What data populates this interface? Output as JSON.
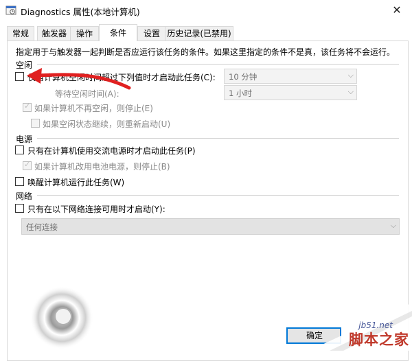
{
  "window": {
    "title": "Diagnostics 属性(本地计算机)",
    "close_glyph": "✕"
  },
  "tabs": [
    {
      "label": "常规"
    },
    {
      "label": "触发器"
    },
    {
      "label": "操作"
    },
    {
      "label": "条件"
    },
    {
      "label": "设置"
    },
    {
      "label": "历史记录(已禁用)"
    }
  ],
  "active_tab": "条件",
  "description": "指定用于与触发器一起判断是否应运行该任务的条件。如果这里指定的条件不是真，该任务将不会运行。",
  "idle": {
    "heading": "空闲",
    "start_if_idle": {
      "label": "仅当计算机空闲时间超过下列值时才启动此任务(C):",
      "checked": false,
      "value": "10 分钟"
    },
    "wait_for_idle": {
      "label": "等待空闲时间(A):",
      "value": "1 小时"
    },
    "stop_if_not_idle": {
      "label": "如果计算机不再空闲，则停止(E)",
      "checked": true
    },
    "restart_if_idle_resumes": {
      "label": "如果空闲状态继续，则重新启动(U)",
      "checked": false
    }
  },
  "power": {
    "heading": "电源",
    "ac_only": {
      "label": "只有在计算机使用交流电源时才启动此任务(P)",
      "checked": false
    },
    "stop_on_battery": {
      "label": "如果计算机改用电池电源，则停止(B)",
      "checked": true
    },
    "wake_to_run": {
      "label": "唤醒计算机运行此任务(W)",
      "checked": false
    }
  },
  "network": {
    "heading": "网络",
    "only_if_available": {
      "label": "只有在以下网络连接可用时才启动(Y):",
      "checked": false
    },
    "connection": "任何连接"
  },
  "buttons": {
    "ok_partial": "确定"
  },
  "watermark": {
    "url": "jb51.net",
    "text": "脚本之家"
  },
  "colors": {
    "annotation_arrow": "#e02020",
    "watermark_text": "#c0392b"
  }
}
